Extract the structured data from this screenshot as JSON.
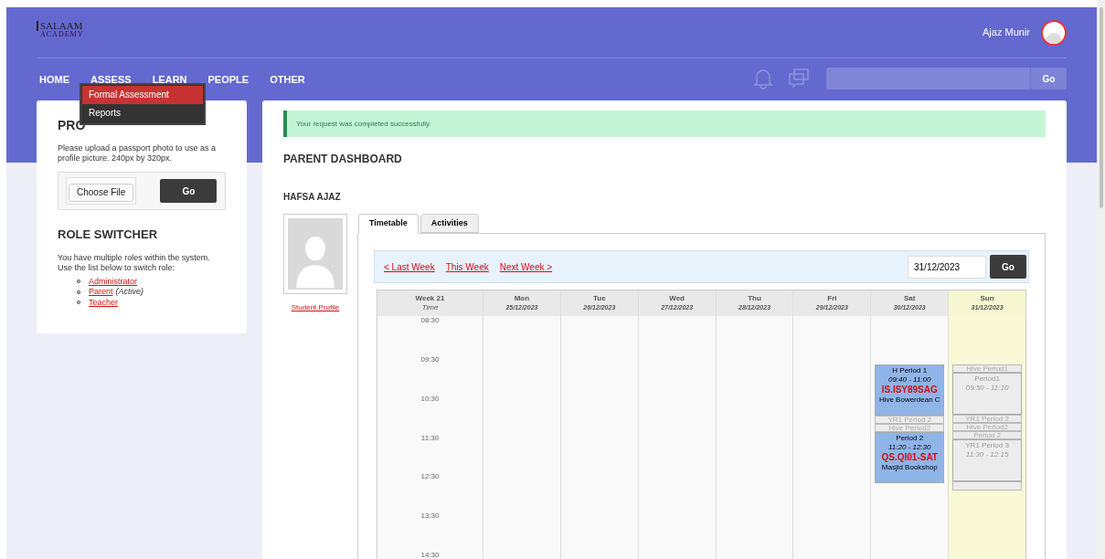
{
  "header": {
    "logo": {
      "line1": "SALAAM",
      "line2": "ACADEMY"
    },
    "user_name": "Ajaz Munir",
    "search": {
      "button": "Go"
    }
  },
  "nav": [
    {
      "label": "HOME"
    },
    {
      "label": "ASSESS",
      "menu": [
        {
          "label": "Formal Assessment",
          "selected": true
        },
        {
          "label": "Reports",
          "selected": false
        }
      ]
    },
    {
      "label": "LEARN"
    },
    {
      "label": "PEOPLE"
    },
    {
      "label": "OTHER"
    }
  ],
  "profile_card": {
    "visible_title": "PRO",
    "text": "Please upload a passport photo to use as a profile picture. 240px by 320px.",
    "file_button": "Choose File",
    "go": "Go"
  },
  "role_switcher": {
    "title": "ROLE SWITCHER",
    "text": "You have multiple roles within the system. Use the list below to switch role:",
    "roles": [
      {
        "label": "Administrator"
      },
      {
        "label": "Parent",
        "active_note": "(Active)"
      },
      {
        "label": "Teacher"
      }
    ]
  },
  "alert": "Your request was completed successfully.",
  "dashboard_title": "PARENT DASHBOARD",
  "student": {
    "name": "HAFSA AJAZ",
    "profile_link": "Student Profile"
  },
  "tabs": [
    {
      "label": "Timetable",
      "selected": true
    },
    {
      "label": "Activities",
      "selected": false
    }
  ],
  "week_nav": {
    "links": [
      "< Last Week",
      "This Week",
      "Next Week >"
    ],
    "date": "31/12/2023",
    "go": "Go"
  },
  "timetable": {
    "week": "Week 21",
    "time_label": "Time",
    "times": [
      "08:30",
      "09:30",
      "10:30",
      "11:30",
      "12:30",
      "13:30",
      "14:30"
    ],
    "days": [
      {
        "name": "Mon",
        "date": "25/12/2023",
        "selected": false
      },
      {
        "name": "Tue",
        "date": "26/12/2023",
        "selected": false
      },
      {
        "name": "Wed",
        "date": "27/12/2023",
        "selected": false
      },
      {
        "name": "Thu",
        "date": "28/12/2023",
        "selected": false
      },
      {
        "name": "Fri",
        "date": "29/12/2023",
        "selected": false
      },
      {
        "name": "Sat",
        "date": "30/12/2023",
        "selected": false,
        "events": [
          {
            "kind": "block",
            "disabled": false,
            "title": "H Period 1",
            "time": "09:40 - 11:00",
            "code": "IS.ISY89SAG",
            "location": "Hive Bowerdean C"
          },
          {
            "kind": "strip",
            "disabled": true,
            "title": "YR1 Period 2"
          },
          {
            "kind": "strip",
            "disabled": true,
            "title": "Hive Period2"
          },
          {
            "kind": "block",
            "disabled": false,
            "title": "Period 2",
            "time": "11:20 - 12:30",
            "code": "QS.QI01-SAT",
            "location": "Masjid Bookshop"
          }
        ]
      },
      {
        "name": "Sun",
        "date": "31/12/2023",
        "selected": true,
        "events": [
          {
            "kind": "strip",
            "disabled": true,
            "title": "Hive Period1"
          },
          {
            "kind": "block",
            "disabled": true,
            "title": "Period1",
            "time": "09:50 - 11:10"
          },
          {
            "kind": "strip",
            "disabled": true,
            "title": "YR1 Period 2"
          },
          {
            "kind": "strip",
            "disabled": true,
            "title": "Hive Period2"
          },
          {
            "kind": "strip",
            "disabled": true,
            "title": "Period 2"
          },
          {
            "kind": "block",
            "disabled": true,
            "title": "YR1 Period 3",
            "time": "11:30 - 12:15"
          },
          {
            "kind": "empty",
            "disabled": true
          }
        ]
      }
    ]
  }
}
